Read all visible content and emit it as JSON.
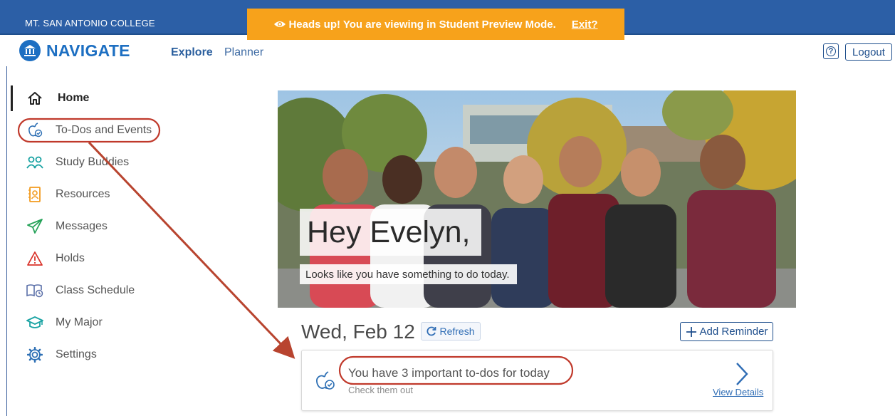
{
  "header": {
    "college_name": "MT. SAN ANTONIO COLLEGE",
    "preview_message": "Heads up! You are viewing in Student Preview Mode.",
    "exit_label": "Exit?",
    "app_name": "NAVIGATE",
    "nav": [
      {
        "label": "Explore",
        "active": true
      },
      {
        "label": "Planner",
        "active": false
      }
    ],
    "help_icon": "question-circle-icon",
    "logout_label": "Logout"
  },
  "sidebar": {
    "items": [
      {
        "label": "Home",
        "icon": "home-icon",
        "active": true
      },
      {
        "label": "To-Dos and Events",
        "icon": "apple-check-icon",
        "highlighted": true
      },
      {
        "label": "Study Buddies",
        "icon": "people-icon"
      },
      {
        "label": "Resources",
        "icon": "address-book-icon"
      },
      {
        "label": "Messages",
        "icon": "paper-plane-icon"
      },
      {
        "label": "Holds",
        "icon": "warning-icon"
      },
      {
        "label": "Class Schedule",
        "icon": "book-clock-icon"
      },
      {
        "label": "My Major",
        "icon": "graduation-cap-icon"
      },
      {
        "label": "Settings",
        "icon": "gear-icon"
      }
    ]
  },
  "hero": {
    "greeting": "Hey Evelyn,",
    "subtitle": "Looks like you have something to do today."
  },
  "day": {
    "date": "Wed, Feb 12",
    "refresh_label": "Refresh",
    "add_reminder_label": "Add Reminder"
  },
  "todo_card": {
    "title": "You have 3 important to-dos for today",
    "subtitle": "Check them out",
    "link_label": "View Details"
  },
  "colors": {
    "header_blue": "#2c5fa6",
    "preview_orange": "#f7a21b",
    "brand_blue": "#1d6fc2",
    "annotation_red": "#c0392b"
  }
}
